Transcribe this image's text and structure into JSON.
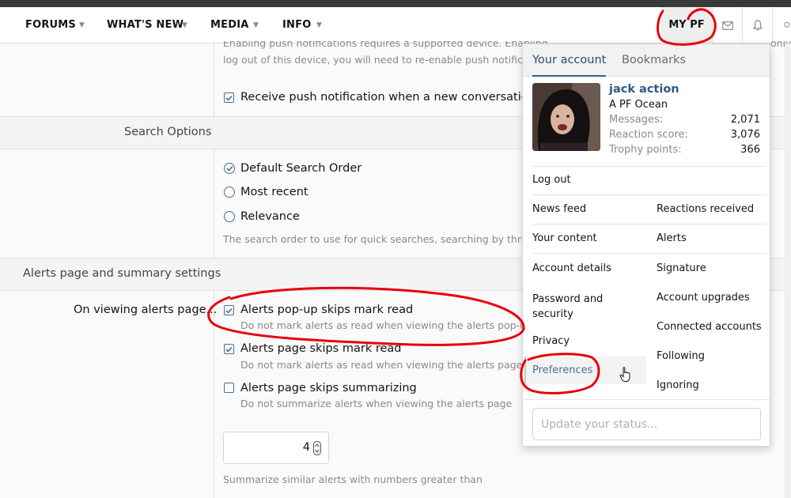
{
  "nav": {
    "items": [
      {
        "label": "FORUMS"
      },
      {
        "label": "WHAT'S NEW"
      },
      {
        "label": "MEDIA"
      },
      {
        "label": "INFO"
      }
    ],
    "my_pf": "MY PF",
    "icons": [
      "envelope-icon",
      "bell-icon",
      "search-icon"
    ]
  },
  "push": {
    "partial_line1": "Enabling push notifications requires a supported device. Enabling",
    "partial_line2": "log out of this device, you will need to re-enable push notificatio",
    "right_fragment": "only. ",
    "conv_label": "Receive push notification when a new conversation m"
  },
  "search": {
    "section_label": "Search Options",
    "options": [
      {
        "label": "Default Search Order",
        "selected": true
      },
      {
        "label": "Most recent",
        "selected": false
      },
      {
        "label": "Relevance",
        "selected": false
      }
    ],
    "hint": "The search order to use for quick searches, searching by thread,"
  },
  "alerts": {
    "section_label": "Alerts page and summary settings",
    "row_label": "On viewing alerts page...",
    "options": [
      {
        "label": "Alerts pop-up skips mark read",
        "hint": "Do not mark alerts as read when viewing the alerts pop-up",
        "checked": true
      },
      {
        "label": "Alerts page skips mark read",
        "hint": "Do not mark alerts as read when viewing the alerts page",
        "checked": true
      },
      {
        "label": "Alerts page skips summarizing",
        "hint": "Do not summarize alerts when viewing the alerts page",
        "checked": false
      }
    ],
    "number_value": "4",
    "number_hint": "Summarize similar alerts with numbers greater than"
  },
  "menu": {
    "tabs": [
      {
        "label": "Your account"
      },
      {
        "label": "Bookmarks"
      }
    ],
    "user": {
      "name": "jack action",
      "title": "A PF Ocean",
      "stats": [
        {
          "label": "Messages:",
          "value": "2,071"
        },
        {
          "label": "Reaction score:",
          "value": "3,076"
        },
        {
          "label": "Trophy points:",
          "value": "366"
        }
      ]
    },
    "logout": "Log out",
    "links_left": [
      "News feed",
      "Your content",
      "Account details",
      "Password and security",
      "Privacy",
      "Preferences"
    ],
    "links_right": [
      "Reactions received",
      "Alerts",
      "Signature",
      "Account upgrades",
      "Connected accounts",
      "Following",
      "Ignoring"
    ],
    "status_placeholder": "Update your status..."
  },
  "colors": {
    "accent": "#3b5f87",
    "username": "#2d5a86",
    "annotation": "#e8000b"
  }
}
